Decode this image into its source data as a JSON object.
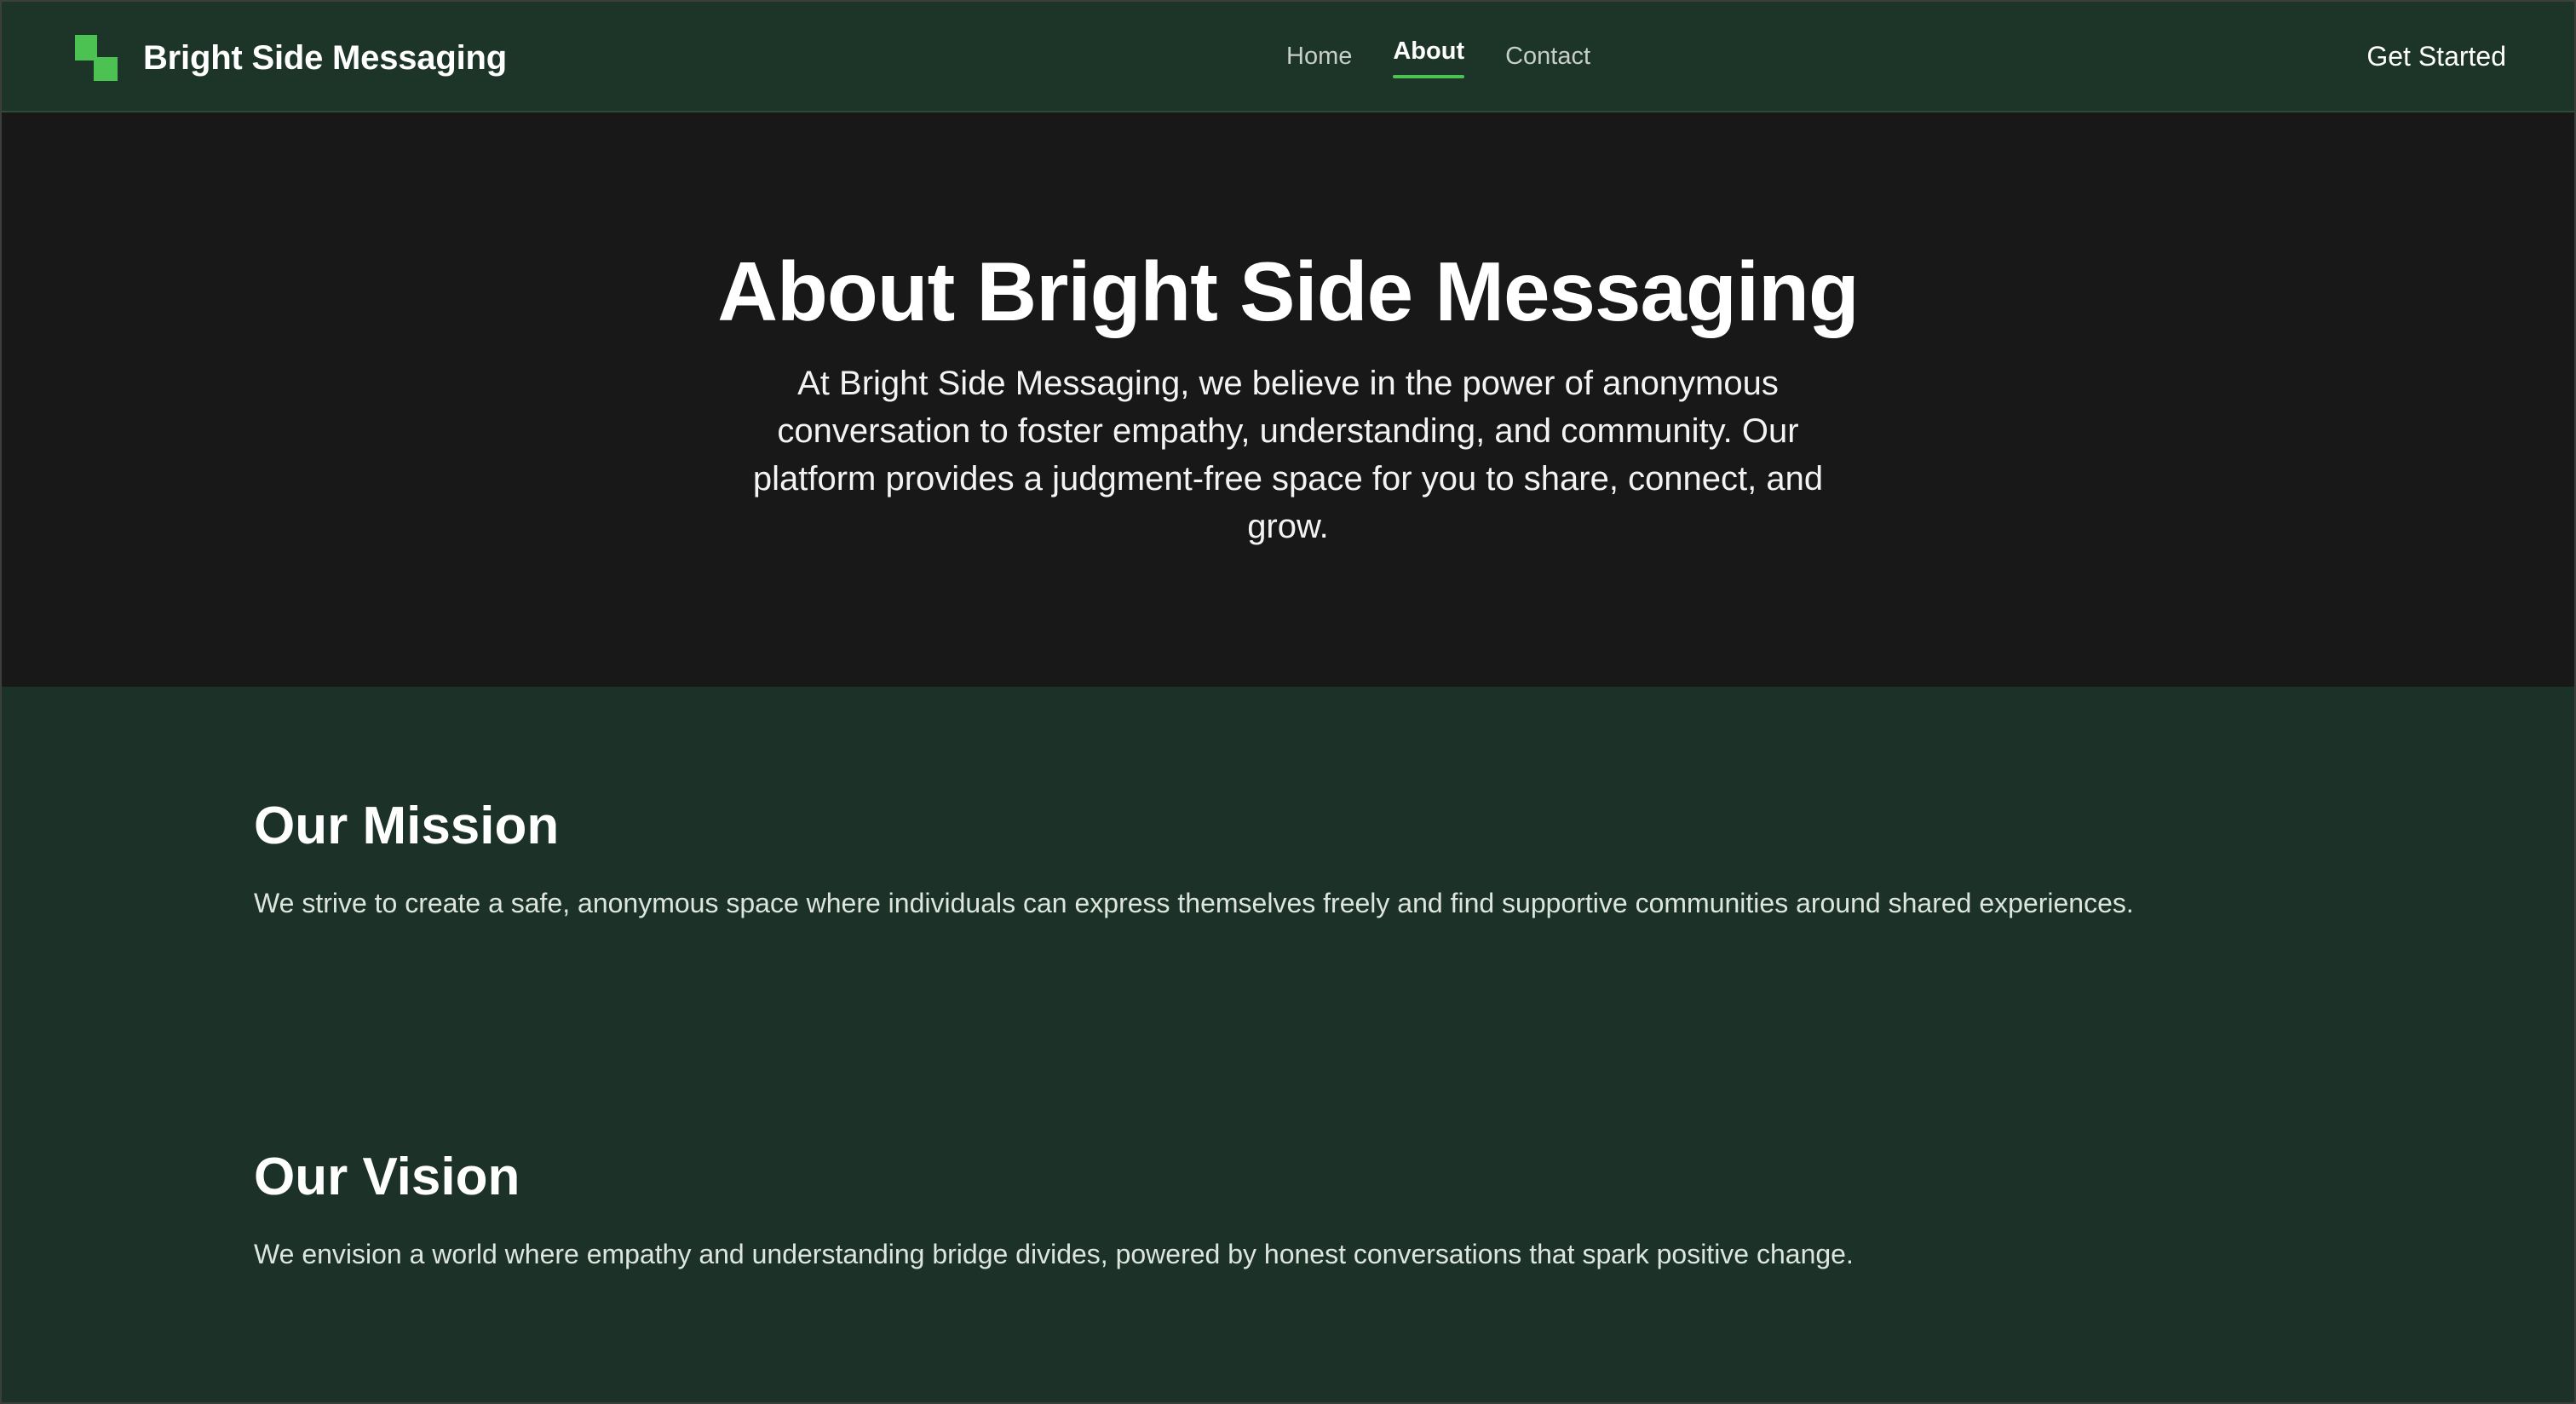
{
  "header": {
    "brand_name": "Bright Side Messaging",
    "logo_icon": "pixel-steps-logo-icon",
    "nav": [
      {
        "label": "Home",
        "active": false
      },
      {
        "label": "About",
        "active": true
      },
      {
        "label": "Contact",
        "active": false
      }
    ],
    "cta_label": "Get Started"
  },
  "hero": {
    "title": "About Bright Side Messaging",
    "description": "At Bright Side Messaging, we believe in the power of anonymous conversation to foster empathy, understanding, and community. Our platform provides a judgment-free space for you to share, connect, and grow."
  },
  "sections": [
    {
      "title": "Our Mission",
      "body": "We strive to create a safe, anonymous space where individuals can express themselves freely and find supportive communities around shared experiences."
    },
    {
      "title": "Our Vision",
      "body": "We envision a world where empathy and understanding bridge divides, powered by honest conversations that spark positive change."
    }
  ],
  "colors": {
    "accent": "#4cc253",
    "header_bg": "#1d3428",
    "hero_bg": "#181818",
    "content_bg": "#1c3228"
  }
}
